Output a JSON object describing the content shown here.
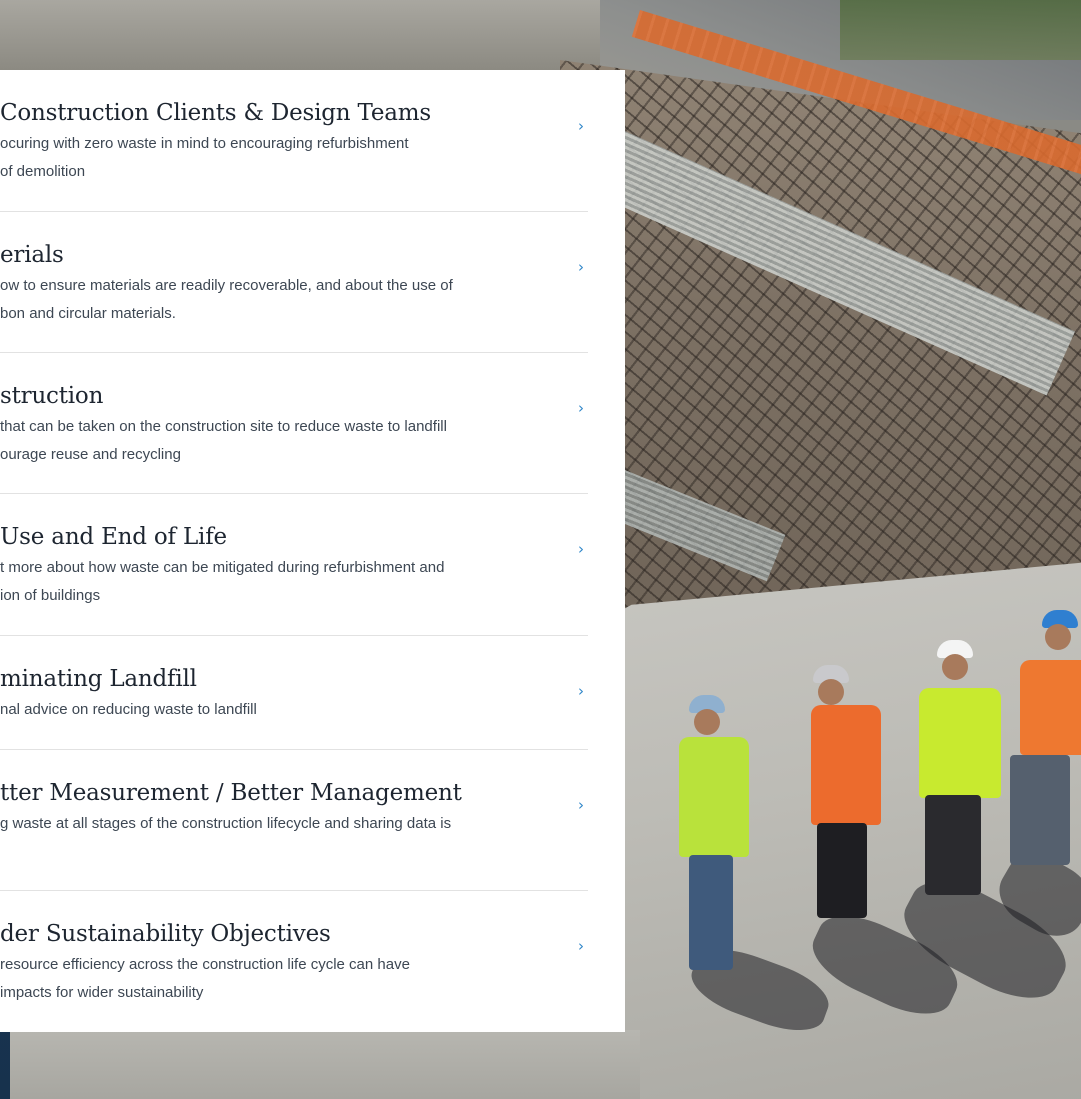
{
  "items": [
    {
      "title": "Construction Clients & Design Teams",
      "desc_line1": "ocuring with zero waste in mind to encouraging refurbishment",
      "desc_line2": "of demolition",
      "chevron": "›"
    },
    {
      "title": "erials",
      "desc_line1": "ow to ensure materials are readily recoverable, and about the use of",
      "desc_line2": "bon and circular materials.",
      "chevron": "›"
    },
    {
      "title": "struction",
      "desc_line1": "that can be taken on the construction site to reduce waste to landfill",
      "desc_line2": "ourage reuse and recycling",
      "chevron": "›"
    },
    {
      "title": "Use and End of Life",
      "desc_line1": "t more about how waste can be mitigated during refurbishment and",
      "desc_line2": "ion of buildings",
      "chevron": "›"
    },
    {
      "title": "minating Landfill",
      "desc_line1": "nal advice on reducing waste to landfill",
      "desc_line2": "",
      "chevron": "›"
    },
    {
      "title": "tter Measurement / Better Management",
      "desc_line1": "g waste at all stages of the construction lifecycle and sharing data is",
      "desc_line2": "",
      "chevron": "›"
    },
    {
      "title": "der Sustainability Objectives",
      "desc_line1": "resource efficiency across the construction life cycle can have",
      "desc_line2": "impacts for wider sustainability",
      "chevron": "›"
    }
  ],
  "colors": {
    "panel_bg": "#ffffff",
    "title_text": "#1d2530",
    "body_text": "#3d4753",
    "chevron": "#2f86c9",
    "divider": "#e2e2e2"
  },
  "background_image": "construction-site-workers-photo"
}
